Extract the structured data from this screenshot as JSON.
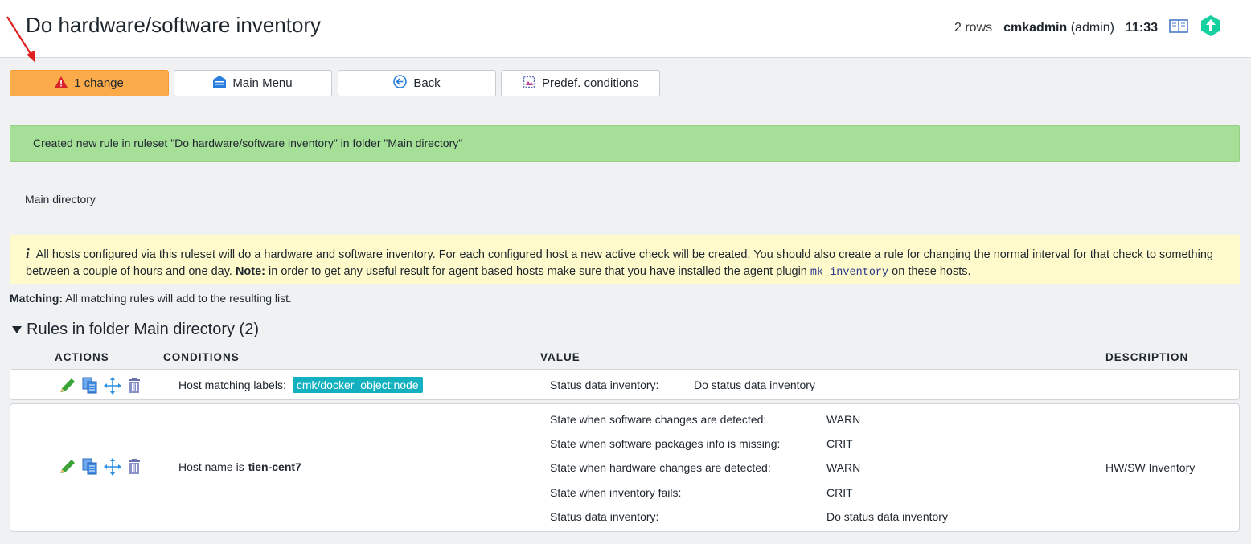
{
  "header": {
    "title": "Do hardware/software inventory",
    "rows": "2 rows",
    "user": "cmkadmin",
    "role": "(admin)",
    "time": "11:33"
  },
  "toolbar": {
    "change_label": "1 change",
    "main_menu_label": "Main Menu",
    "back_label": "Back",
    "predef_label": "Predef. conditions"
  },
  "success_message": "Created new rule in ruleset \"Do hardware/software inventory\" in folder \"Main directory\"",
  "breadcrumb": "Main directory",
  "help": {
    "text1": "All hosts configured via this ruleset will do a hardware and software inventory. For each configured host a new active check will be created. You should also create a rule for changing the normal interval for that check to something between a couple of hours and one day.",
    "note_label": "Note:",
    "text2": "in order to get any useful result for agent based hosts make sure that you have installed the agent plugin",
    "code": "mk_inventory",
    "text3": "on these hosts."
  },
  "matching": {
    "label": "Matching:",
    "text": "All matching rules will add to the resulting list."
  },
  "section": {
    "title": "Rules in folder Main directory (2)"
  },
  "table": {
    "headers": [
      "ACTIONS",
      "CONDITIONS",
      "VALUE",
      "DESCRIPTION"
    ],
    "rows": [
      {
        "condition_prefix": "Host matching labels:",
        "condition_label": "cmk/docker_object:node",
        "values": [
          {
            "key": "Status data inventory:",
            "value": "Do status data inventory"
          }
        ],
        "description": ""
      },
      {
        "condition_prefix": "Host name is",
        "condition_host": "tien-cent7",
        "values": [
          {
            "key": "State when software changes are detected:",
            "value": "WARN"
          },
          {
            "key": "State when software packages info is missing:",
            "value": "CRIT"
          },
          {
            "key": "State when hardware changes are detected:",
            "value": "WARN"
          },
          {
            "key": "State when inventory fails:",
            "value": "CRIT"
          },
          {
            "key": "Status data inventory:",
            "value": "Do status data inventory"
          }
        ],
        "description": "HW/SW Inventory"
      }
    ]
  },
  "colors": {
    "change_button": "#fbab4a",
    "success_bg": "#a6e098",
    "help_bg": "#fffacb",
    "label_chip": "#13b1c0",
    "logo_green": "#15d1a0"
  },
  "icons": [
    "warning-icon",
    "main-menu-icon",
    "back-icon",
    "predef-conditions-icon",
    "edit-icon",
    "clone-icon",
    "move-icon",
    "delete-icon",
    "help-book-icon",
    "checkmk-logo-icon",
    "collapse-triangle-icon"
  ]
}
